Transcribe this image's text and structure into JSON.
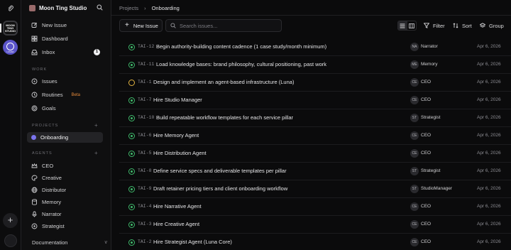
{
  "workspace": {
    "name": "Moon Ting Studio",
    "logo_text": "MOON TING STUDIO",
    "alt_label": "LUNAR"
  },
  "sidebar": {
    "top": [
      {
        "label": "New Issue",
        "icon": "edit-icon"
      },
      {
        "label": "Dashboard",
        "icon": "dashboard-icon"
      },
      {
        "label": "Inbox",
        "icon": "inbox-icon",
        "count": "1"
      }
    ],
    "work_title": "WORK",
    "work": [
      {
        "label": "Issues",
        "icon": "issues-icon"
      },
      {
        "label": "Routines",
        "icon": "routines-icon",
        "badge": "Beta"
      },
      {
        "label": "Goals",
        "icon": "goals-icon"
      }
    ],
    "projects_title": "PROJECTS",
    "projects": [
      {
        "label": "Onboarding",
        "color": "#7b74ee"
      }
    ],
    "agents_title": "AGENTS",
    "agents": [
      {
        "label": "CEO",
        "icon": "crown-icon"
      },
      {
        "label": "Creative",
        "icon": "palette-icon"
      },
      {
        "label": "Distributor",
        "icon": "globe-icon"
      },
      {
        "label": "Memory",
        "icon": "database-icon"
      },
      {
        "label": "Narrator",
        "icon": "mic-icon"
      },
      {
        "label": "Strategist",
        "icon": "target-icon"
      }
    ],
    "footer": "Documentation"
  },
  "header": {
    "breadcrumb": [
      "Projects",
      "Onboarding"
    ]
  },
  "toolbar": {
    "new_issue": "New Issue",
    "search_placeholder": "Search issues...",
    "filter": "Filter",
    "sort": "Sort",
    "group": "Group"
  },
  "issues": [
    {
      "key": "TAI-12",
      "title": "Begin authority-building content cadence (1 case study/month minimum)",
      "status": "in-progress",
      "initials": "NA",
      "assignee": "Narrator",
      "date": "Apr 6, 2026"
    },
    {
      "key": "TAI-11",
      "title": "Load knowledge bases: brand philosophy, cultural positioning, past work",
      "status": "in-progress",
      "initials": "ME",
      "assignee": "Memory",
      "date": "Apr 6, 2026"
    },
    {
      "key": "TAI-1",
      "title": "Design and implement an agent-based infrastructure (Luna)",
      "status": "todo",
      "initials": "CE",
      "assignee": "CEO",
      "date": "Apr 6, 2026"
    },
    {
      "key": "TAI-7",
      "title": "Hire Studio Manager",
      "status": "in-progress",
      "initials": "CE",
      "assignee": "CEO",
      "date": "Apr 6, 2026"
    },
    {
      "key": "TAI-10",
      "title": "Build repeatable workflow templates for each service pillar",
      "status": "in-progress",
      "initials": "ST",
      "assignee": "Strategist",
      "date": "Apr 6, 2026"
    },
    {
      "key": "TAI-6",
      "title": "Hire Memory Agent",
      "status": "in-progress",
      "initials": "CE",
      "assignee": "CEO",
      "date": "Apr 6, 2026"
    },
    {
      "key": "TAI-5",
      "title": "Hire Distribution Agent",
      "status": "in-progress",
      "initials": "CE",
      "assignee": "CEO",
      "date": "Apr 6, 2026"
    },
    {
      "key": "TAI-8",
      "title": "Define service specs and deliverable templates per pillar",
      "status": "in-progress",
      "initials": "ST",
      "assignee": "Strategist",
      "date": "Apr 6, 2026"
    },
    {
      "key": "TAI-9",
      "title": "Draft retainer pricing tiers and client onboarding workflow",
      "status": "in-progress",
      "initials": "ST",
      "assignee": "StudioManager",
      "date": "Apr 6, 2026"
    },
    {
      "key": "TAI-4",
      "title": "Hire Narrative Agent",
      "status": "in-progress",
      "initials": "CE",
      "assignee": "CEO",
      "date": "Apr 6, 2026"
    },
    {
      "key": "TAI-3",
      "title": "Hire Creative Agent",
      "status": "in-progress",
      "initials": "CE",
      "assignee": "CEO",
      "date": "Apr 6, 2026"
    },
    {
      "key": "TAI-2",
      "title": "Hire Strategist Agent (Luna Core)",
      "status": "in-progress",
      "initials": "CE",
      "assignee": "CEO",
      "date": "Apr 6, 2026"
    }
  ]
}
